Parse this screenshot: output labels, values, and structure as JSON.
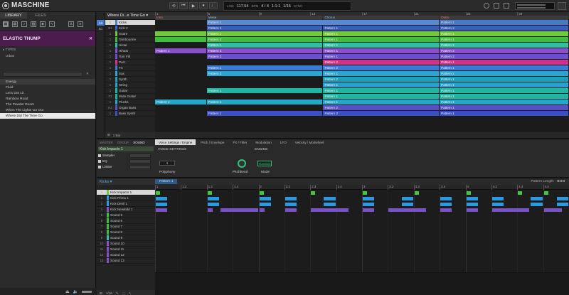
{
  "app": {
    "name": "MASCHINE",
    "bpm": "117.54",
    "bpm_unit": "BPM",
    "time_sig": "4 / 4",
    "position": "1:1:1",
    "grid": "1/16",
    "link": "LINK",
    "sync": "SYNC"
  },
  "browser": {
    "tabs": [
      "LIBRARY",
      "FILES"
    ],
    "product": "ELASTIC THUMP",
    "types_label": "TYPES",
    "type_tag": "Urban",
    "files": [
      "Energy",
      "Fluid",
      "Let's Get Lit",
      "Rainbow Road",
      "The Powder Room",
      "When The Lights Go Out",
      "Where Did The Time Go"
    ],
    "selected_index": 6
  },
  "arranger": {
    "project": "Where Di...e Time Go",
    "groups": [
      "A1",
      "B1"
    ],
    "sounds": [
      {
        "n": "1",
        "name": "Kicks",
        "color": "#4a7fd0"
      },
      {
        "n": "B1",
        "name": "Kick 2",
        "color": "#3b62c4"
      },
      {
        "n": "1",
        "name": "Snare",
        "color": "#6fc93b"
      },
      {
        "n": "1",
        "name": "Tambourine",
        "color": "#3fbd3f"
      },
      {
        "n": "1",
        "name": "HiHat",
        "color": "#2fbfa3"
      },
      {
        "n": "1",
        "name": "Hihats",
        "color": "#8a4fd0"
      },
      {
        "n": "1",
        "name": "Tom Fill",
        "color": "#6a4fd0"
      },
      {
        "n": "1",
        "name": "Perc",
        "color": "#d0348a"
      },
      {
        "n": "1",
        "name": "FX",
        "color": "#3a7ad8"
      },
      {
        "n": "1",
        "name": "Sax",
        "color": "#2aa4d0"
      },
      {
        "n": "1",
        "name": "Synth",
        "color": "#1aa0b8"
      },
      {
        "n": "1",
        "name": "String",
        "color": "#2aa0d0"
      },
      {
        "n": "1",
        "name": "Guitar",
        "color": "#1fb5a3"
      },
      {
        "n": "F2",
        "name": "Mute Guitar",
        "color": "#1fb5a3"
      },
      {
        "n": "1",
        "name": "Plucks",
        "color": "#22a8c8"
      },
      {
        "n": "H2",
        "name": "Organ Bass",
        "color": "#5a4fc8"
      },
      {
        "n": "1",
        "name": "Bass Synth",
        "color": "#3a4fc8"
      }
    ],
    "sections": [
      "Intro",
      "Verse",
      "Chorus",
      "Outro"
    ],
    "ticks": [
      "1",
      "5",
      "9",
      "13",
      "17",
      "21",
      "25",
      "29"
    ],
    "bar_label": "1 Bar",
    "clip_label": "Pattern 1",
    "clip_label2": "Pattern 2"
  },
  "control": {
    "tabs": [
      "MASTER",
      "GROUP",
      "SOUND"
    ],
    "sound_name": "Kick Impacto 1",
    "plugins": [
      "Sampler",
      "EQ",
      "Limiter"
    ],
    "param_tabs": [
      "Voice Settings / Engine",
      "Pitch / Envelope",
      "FX / Filter",
      "Modulation",
      "LFO",
      "Velocity / Modwheel"
    ],
    "voice_settings": "VOICE SETTINGS",
    "engine": "ENGINE",
    "polyphony_value": "1",
    "polyphony": "Polyphony",
    "pitchbend": "Pitchbend",
    "mode_value": "Standard",
    "mode": "Mode"
  },
  "pattern_editor": {
    "group_label": "Kicks",
    "pattern": "Pattern 1",
    "pattern_length_label": "Pattern Length:",
    "pattern_length": "8:0:0",
    "ticks": [
      "1",
      "1.2",
      "1.3",
      "1.4",
      "2",
      "2.2",
      "2.3",
      "2.4",
      "3",
      "3.2",
      "3.3",
      "3.4",
      "4",
      "4.2",
      "4.3",
      "4.4"
    ],
    "sounds": [
      {
        "n": "1",
        "name": "Kick Impacto 1",
        "color": "#6fc93b"
      },
      {
        "n": "1",
        "name": "Kick Prima 1",
        "color": "#2a9ae0"
      },
      {
        "n": "1",
        "name": "Kick Devil 1",
        "color": "#2a9ae0"
      },
      {
        "n": "1",
        "name": "Kick Newkidd 1",
        "color": "#8a4fd0"
      },
      {
        "n": "5",
        "name": "Sound 5",
        "color": "#3fbd3f"
      },
      {
        "n": "6",
        "name": "Sound 6",
        "color": "#3fbd3f"
      },
      {
        "n": "7",
        "name": "Sound 7",
        "color": "#3fbd3f"
      },
      {
        "n": "8",
        "name": "Sound 8",
        "color": "#3fbd3f"
      },
      {
        "n": "9",
        "name": "Sound 9",
        "color": "#2fbfa3"
      },
      {
        "n": "10",
        "name": "Sound 10",
        "color": "#8a4fd0"
      },
      {
        "n": "11",
        "name": "Sound 11",
        "color": "#8a4fd0"
      },
      {
        "n": "12",
        "name": "Sound 12",
        "color": "#8a4fd0"
      },
      {
        "n": "13",
        "name": "Sound 13",
        "color": "#8a4fd0"
      }
    ],
    "grid_value": "1/16"
  }
}
